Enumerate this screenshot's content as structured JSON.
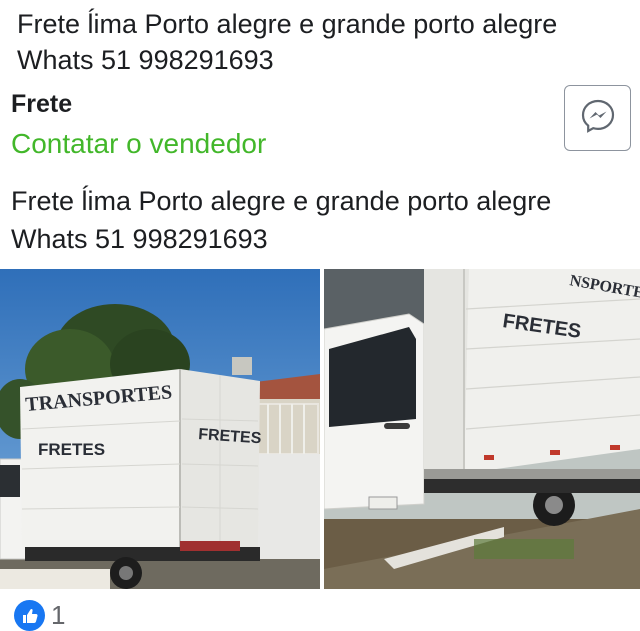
{
  "post": {
    "top_line1": "Frete ĺima Porto alegre e grande porto alegre",
    "top_line2": "Whats 51 998291693"
  },
  "listing": {
    "title": "Frete",
    "contact_label": "Contatar o vendedor",
    "description_line1": "Frete ĺima Porto alegre e grande porto alegre",
    "description_line2": "Whats 51 998291693"
  },
  "photos": {
    "left": {
      "sign_main": "TRANSPORTES",
      "sign_side": "FRETES",
      "sign_side2": "FRETES"
    },
    "right": {
      "sign_top": "NSPORTE",
      "sign_side": "FRETES"
    }
  },
  "reactions": {
    "icon": "thumbs-up-icon",
    "count": "1",
    "color": "#1877f2"
  },
  "colors": {
    "contact_link": "#42b72a",
    "text": "#1c1e21"
  }
}
